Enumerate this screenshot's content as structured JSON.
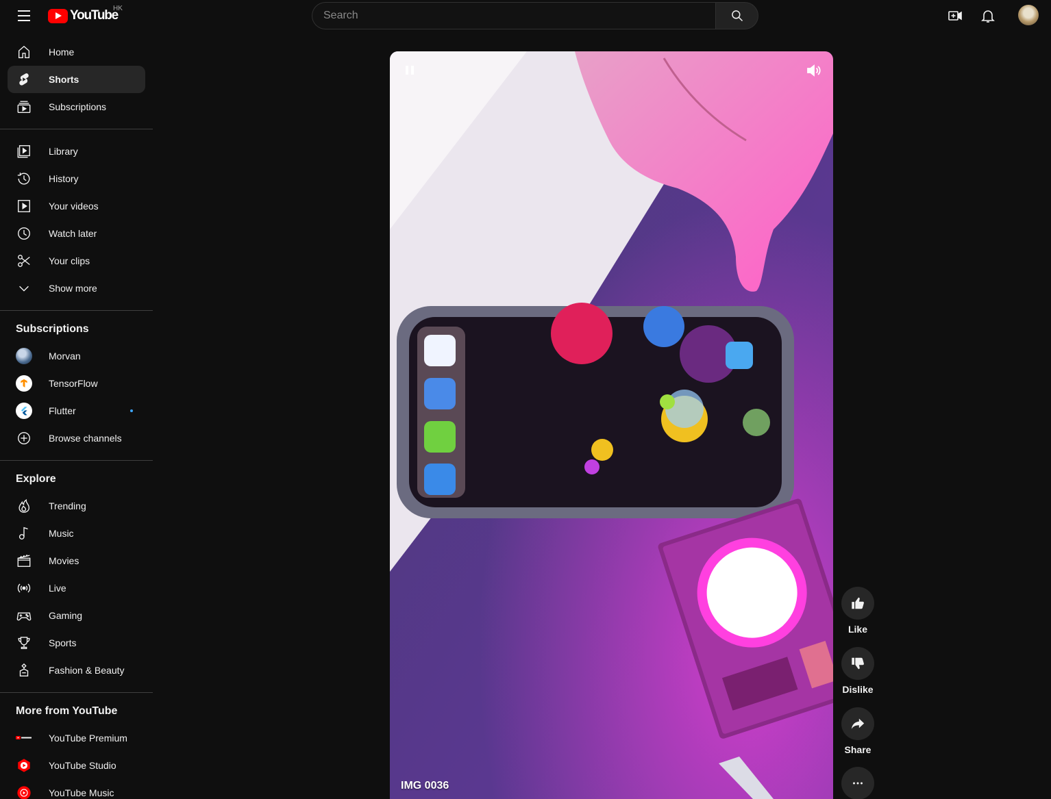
{
  "header": {
    "logo_text": "YouTube",
    "region": "HK",
    "search_placeholder": "Search"
  },
  "sidebar": {
    "main": [
      {
        "label": "Home",
        "icon": "home-icon"
      },
      {
        "label": "Shorts",
        "icon": "shorts-icon",
        "active": true
      },
      {
        "label": "Subscriptions",
        "icon": "subscriptions-icon"
      }
    ],
    "you": [
      {
        "label": "Library",
        "icon": "library-icon"
      },
      {
        "label": "History",
        "icon": "history-icon"
      },
      {
        "label": "Your videos",
        "icon": "your-videos-icon"
      },
      {
        "label": "Watch later",
        "icon": "watch-later-icon"
      },
      {
        "label": "Your clips",
        "icon": "scissors-icon"
      },
      {
        "label": "Show more",
        "icon": "chevron-down-icon"
      }
    ],
    "subscriptions_title": "Subscriptions",
    "subscriptions": [
      {
        "label": "Morvan"
      },
      {
        "label": "TensorFlow"
      },
      {
        "label": "Flutter",
        "new_content": true
      },
      {
        "label": "Browse channels",
        "icon": "add-circle-icon"
      }
    ],
    "explore_title": "Explore",
    "explore": [
      {
        "label": "Trending",
        "icon": "trending-icon"
      },
      {
        "label": "Music",
        "icon": "music-icon"
      },
      {
        "label": "Movies",
        "icon": "movies-icon"
      },
      {
        "label": "Live",
        "icon": "live-icon"
      },
      {
        "label": "Gaming",
        "icon": "gaming-icon"
      },
      {
        "label": "Sports",
        "icon": "trophy-icon"
      },
      {
        "label": "Fashion & Beauty",
        "icon": "hanger-icon"
      }
    ],
    "more_title": "More from YouTube",
    "more": [
      {
        "label": "YouTube Premium"
      },
      {
        "label": "YouTube Studio"
      },
      {
        "label": "YouTube Music"
      }
    ]
  },
  "player": {
    "title": "IMG 0036",
    "state": "playing"
  },
  "actions": {
    "like": "Like",
    "dislike": "Dislike",
    "share": "Share"
  },
  "colors": {
    "background": "#0f0f0f",
    "active_item": "#272727",
    "brand_red": "#ff0000",
    "new_dot": "#3ea6ff"
  }
}
